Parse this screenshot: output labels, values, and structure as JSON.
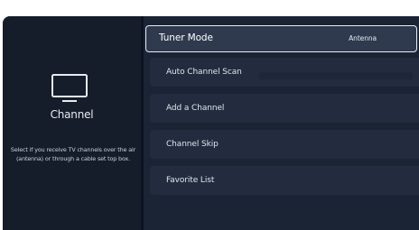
{
  "category": {
    "icon": "tv-icon",
    "title": "Channel",
    "description": "Select if you receive TV channels over the air (antenna) or through a cable set top box."
  },
  "menu": {
    "items": [
      {
        "label": "Tuner Mode",
        "value": "Antenna"
      },
      {
        "label": "Auto Channel Scan"
      },
      {
        "label": "Add a Channel"
      },
      {
        "label": "Channel Skip"
      },
      {
        "label": "Favorite List"
      }
    ]
  },
  "colors": {
    "background": "#141c2a",
    "menu_item": "#222c3e",
    "selected_item": "#2f3a4f",
    "focus_border": "#e8ecf2"
  }
}
